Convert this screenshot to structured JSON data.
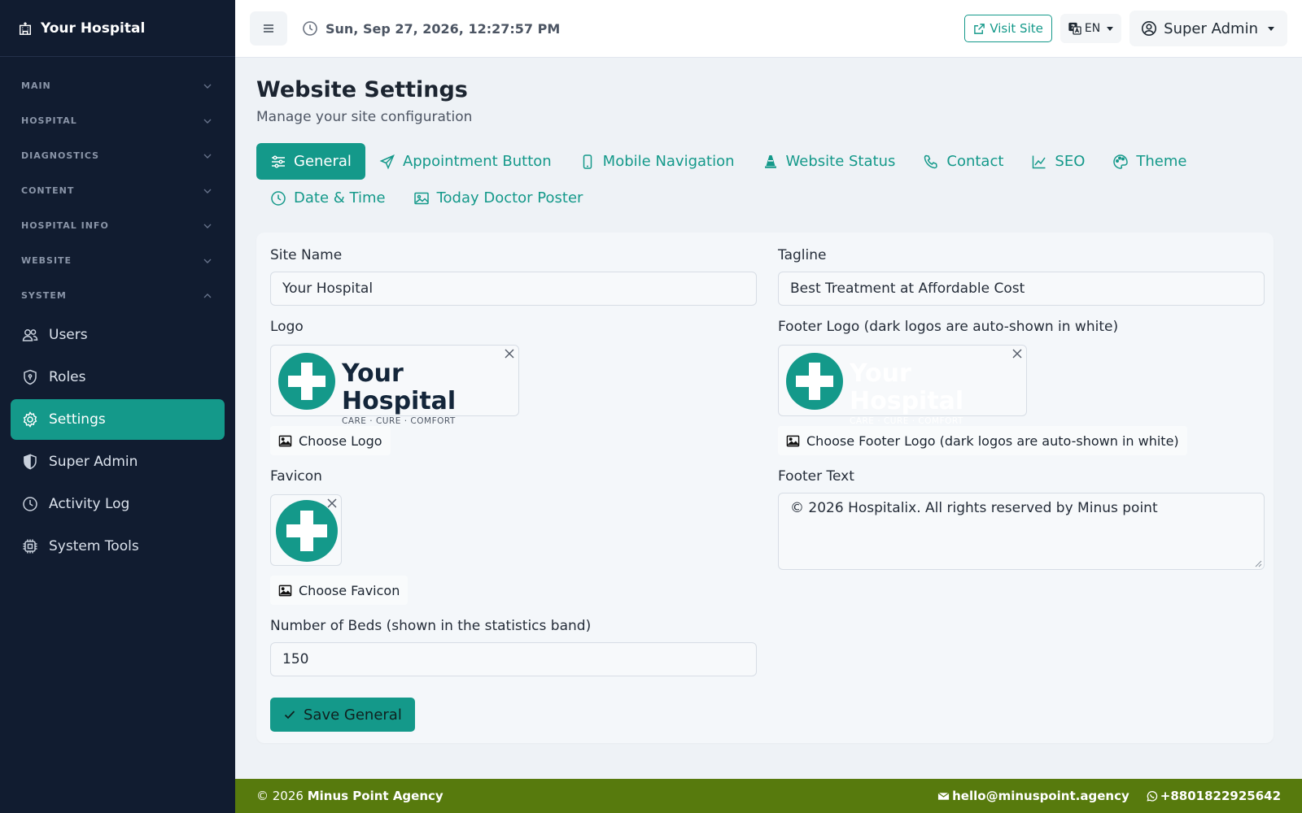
{
  "brand": {
    "name": "Your Hospital"
  },
  "sidebar": {
    "sections": [
      {
        "label": "MAIN",
        "expanded": false
      },
      {
        "label": "HOSPITAL",
        "expanded": false
      },
      {
        "label": "DIAGNOSTICS",
        "expanded": false
      },
      {
        "label": "CONTENT",
        "expanded": false
      },
      {
        "label": "HOSPITAL INFO",
        "expanded": false
      },
      {
        "label": "WEBSITE",
        "expanded": false
      },
      {
        "label": "SYSTEM",
        "expanded": true
      }
    ],
    "items": [
      {
        "label": "Users",
        "icon": "users-icon"
      },
      {
        "label": "Roles",
        "icon": "shield-icon"
      },
      {
        "label": "Settings",
        "icon": "gear-icon",
        "active": true
      },
      {
        "label": "Super Admin",
        "icon": "half-shield-icon"
      },
      {
        "label": "Activity Log",
        "icon": "clock-icon"
      },
      {
        "label": "System Tools",
        "icon": "cpu-icon"
      }
    ]
  },
  "header": {
    "datetime": "Sun, Sep 27, 2026, 12:27:57 PM",
    "visit_site": "Visit Site",
    "language": "EN",
    "user": "Super Admin"
  },
  "page": {
    "title": "Website Settings",
    "subtitle": "Manage your site configuration"
  },
  "tabs": [
    {
      "label": "General",
      "icon": "sliders-icon",
      "active": true
    },
    {
      "label": "Appointment Button",
      "icon": "send-icon"
    },
    {
      "label": "Mobile Navigation",
      "icon": "phone-device-icon"
    },
    {
      "label": "Website Status",
      "icon": "cone-icon"
    },
    {
      "label": "Contact",
      "icon": "telephone-icon"
    },
    {
      "label": "SEO",
      "icon": "line-chart-icon"
    },
    {
      "label": "Theme",
      "icon": "palette-icon"
    },
    {
      "label": "Date & Time",
      "icon": "clock-icon"
    },
    {
      "label": "Today Doctor Poster",
      "icon": "image-icon"
    }
  ],
  "form": {
    "site_name": {
      "label": "Site Name",
      "value": "Your Hospital"
    },
    "tagline": {
      "label": "Tagline",
      "value": "Best Treatment at Affordable Cost"
    },
    "logo": {
      "label": "Logo",
      "choose": "Choose Logo",
      "logo_word": "Your Hospital",
      "logo_tag": "CARE · CURE · COMFORT"
    },
    "footer_logo": {
      "label": "Footer Logo (dark logos are auto-shown in white)",
      "choose": "Choose Footer Logo (dark logos are auto-shown in white)"
    },
    "favicon": {
      "label": "Favicon",
      "choose": "Choose Favicon"
    },
    "footer_text": {
      "label": "Footer Text",
      "value": "© 2026 Hospitalix. All rights reserved by Minus point"
    },
    "beds": {
      "label": "Number of Beds (shown in the statistics band)",
      "value": "150"
    },
    "save": "Save General"
  },
  "footer": {
    "copyright_prefix": "© 2026",
    "agency": "Minus Point Agency",
    "email": "hello@minuspoint.agency",
    "phone": "+8801822925642"
  },
  "colors": {
    "sidebar_bg": "#111c30",
    "accent": "#14998a",
    "footer_bg": "#577a0d",
    "logo_text": "#14263a"
  }
}
